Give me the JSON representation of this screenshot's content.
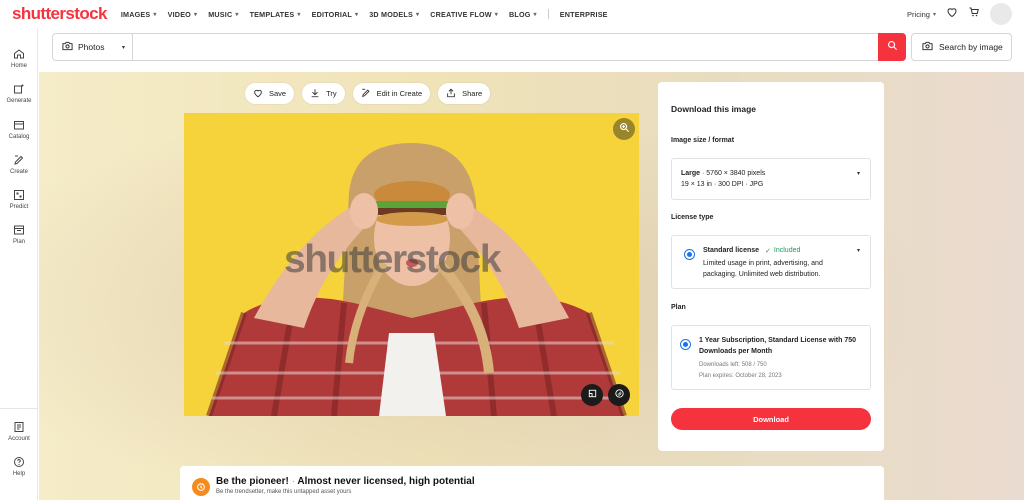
{
  "brand": {
    "logo": "shutterstock",
    "accent": "#f5333f",
    "link_blue": "#1a73e8"
  },
  "nav": {
    "items": [
      {
        "label": "IMAGES",
        "dropdown": true
      },
      {
        "label": "VIDEO",
        "dropdown": true
      },
      {
        "label": "MUSIC",
        "dropdown": true
      },
      {
        "label": "TEMPLATES",
        "dropdown": true
      },
      {
        "label": "EDITORIAL",
        "dropdown": true
      },
      {
        "label": "3D MODELS",
        "dropdown": true
      },
      {
        "label": "CREATIVE FLOW",
        "dropdown": true
      },
      {
        "label": "BLOG",
        "dropdown": true
      },
      {
        "label": "ENTERPRISE",
        "dropdown": false
      }
    ],
    "pricing": "Pricing"
  },
  "sidebar": {
    "top": [
      {
        "label": "Home",
        "icon": "home-icon"
      },
      {
        "label": "Generate",
        "icon": "generate-icon"
      },
      {
        "label": "Catalog",
        "icon": "catalog-icon"
      },
      {
        "label": "Create",
        "icon": "create-icon"
      },
      {
        "label": "Predict",
        "icon": "predict-icon"
      },
      {
        "label": "Plan",
        "icon": "plan-icon"
      }
    ],
    "bottom": [
      {
        "label": "Account",
        "icon": "account-icon"
      },
      {
        "label": "Help",
        "icon": "help-icon"
      }
    ]
  },
  "search": {
    "type": "Photos",
    "value": "",
    "by_image": "Search by image"
  },
  "actions": {
    "save": "Save",
    "try": "Try",
    "edit": "Edit in Create",
    "share": "Share"
  },
  "image": {
    "watermark": "shutterstock"
  },
  "panel": {
    "title": "Download this image",
    "size_label": "Image size / format",
    "size_name": "Large",
    "size_dims": "· 5760 × 3840 pixels",
    "size_detail": "19 × 13 in · 300 DPI · JPG",
    "license_label": "License type",
    "license_name": "Standard license",
    "license_badge": "Included",
    "license_desc": "Limited usage in print, advertising, and packaging. Unlimited web distribution.",
    "plan_label": "Plan",
    "plan_name": "1 Year Subscription, Standard License with 750 Downloads per Month",
    "plan_downloads": "Downloads left: 508 / 750",
    "plan_expires": "Plan expires: October 28, 2023",
    "download": "Download"
  },
  "banner": {
    "title_bold": "Be the pioneer!",
    "title_rest": "Almost never licensed, high potential",
    "subtitle": "Be the trendsetter, make this untapped asset yours"
  }
}
